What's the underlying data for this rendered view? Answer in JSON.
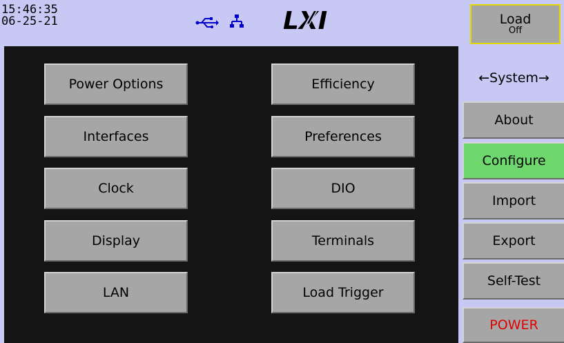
{
  "status": {
    "time": "15:46:35",
    "date": "06-25-21",
    "usb_icon": "usb-icon",
    "lan_icon": "network-icon",
    "logo_text": "LXI"
  },
  "load": {
    "title": "Load",
    "state": "Off",
    "border_color": "#e0d800"
  },
  "menu": {
    "left": [
      "Power Options",
      "Interfaces",
      "Clock",
      "Display",
      "LAN"
    ],
    "right": [
      "Efficiency",
      "Preferences",
      "DIO",
      "Terminals",
      "Load Trigger"
    ]
  },
  "sidebar": {
    "title": "←System→",
    "items": [
      {
        "label": "About",
        "active": false
      },
      {
        "label": "Configure",
        "active": true
      },
      {
        "label": "Import",
        "active": false
      },
      {
        "label": "Export",
        "active": false
      },
      {
        "label": "Self-Test",
        "active": false
      }
    ],
    "power_label": "POWER",
    "active_color": "#6ed86e",
    "power_color": "#e00000"
  }
}
